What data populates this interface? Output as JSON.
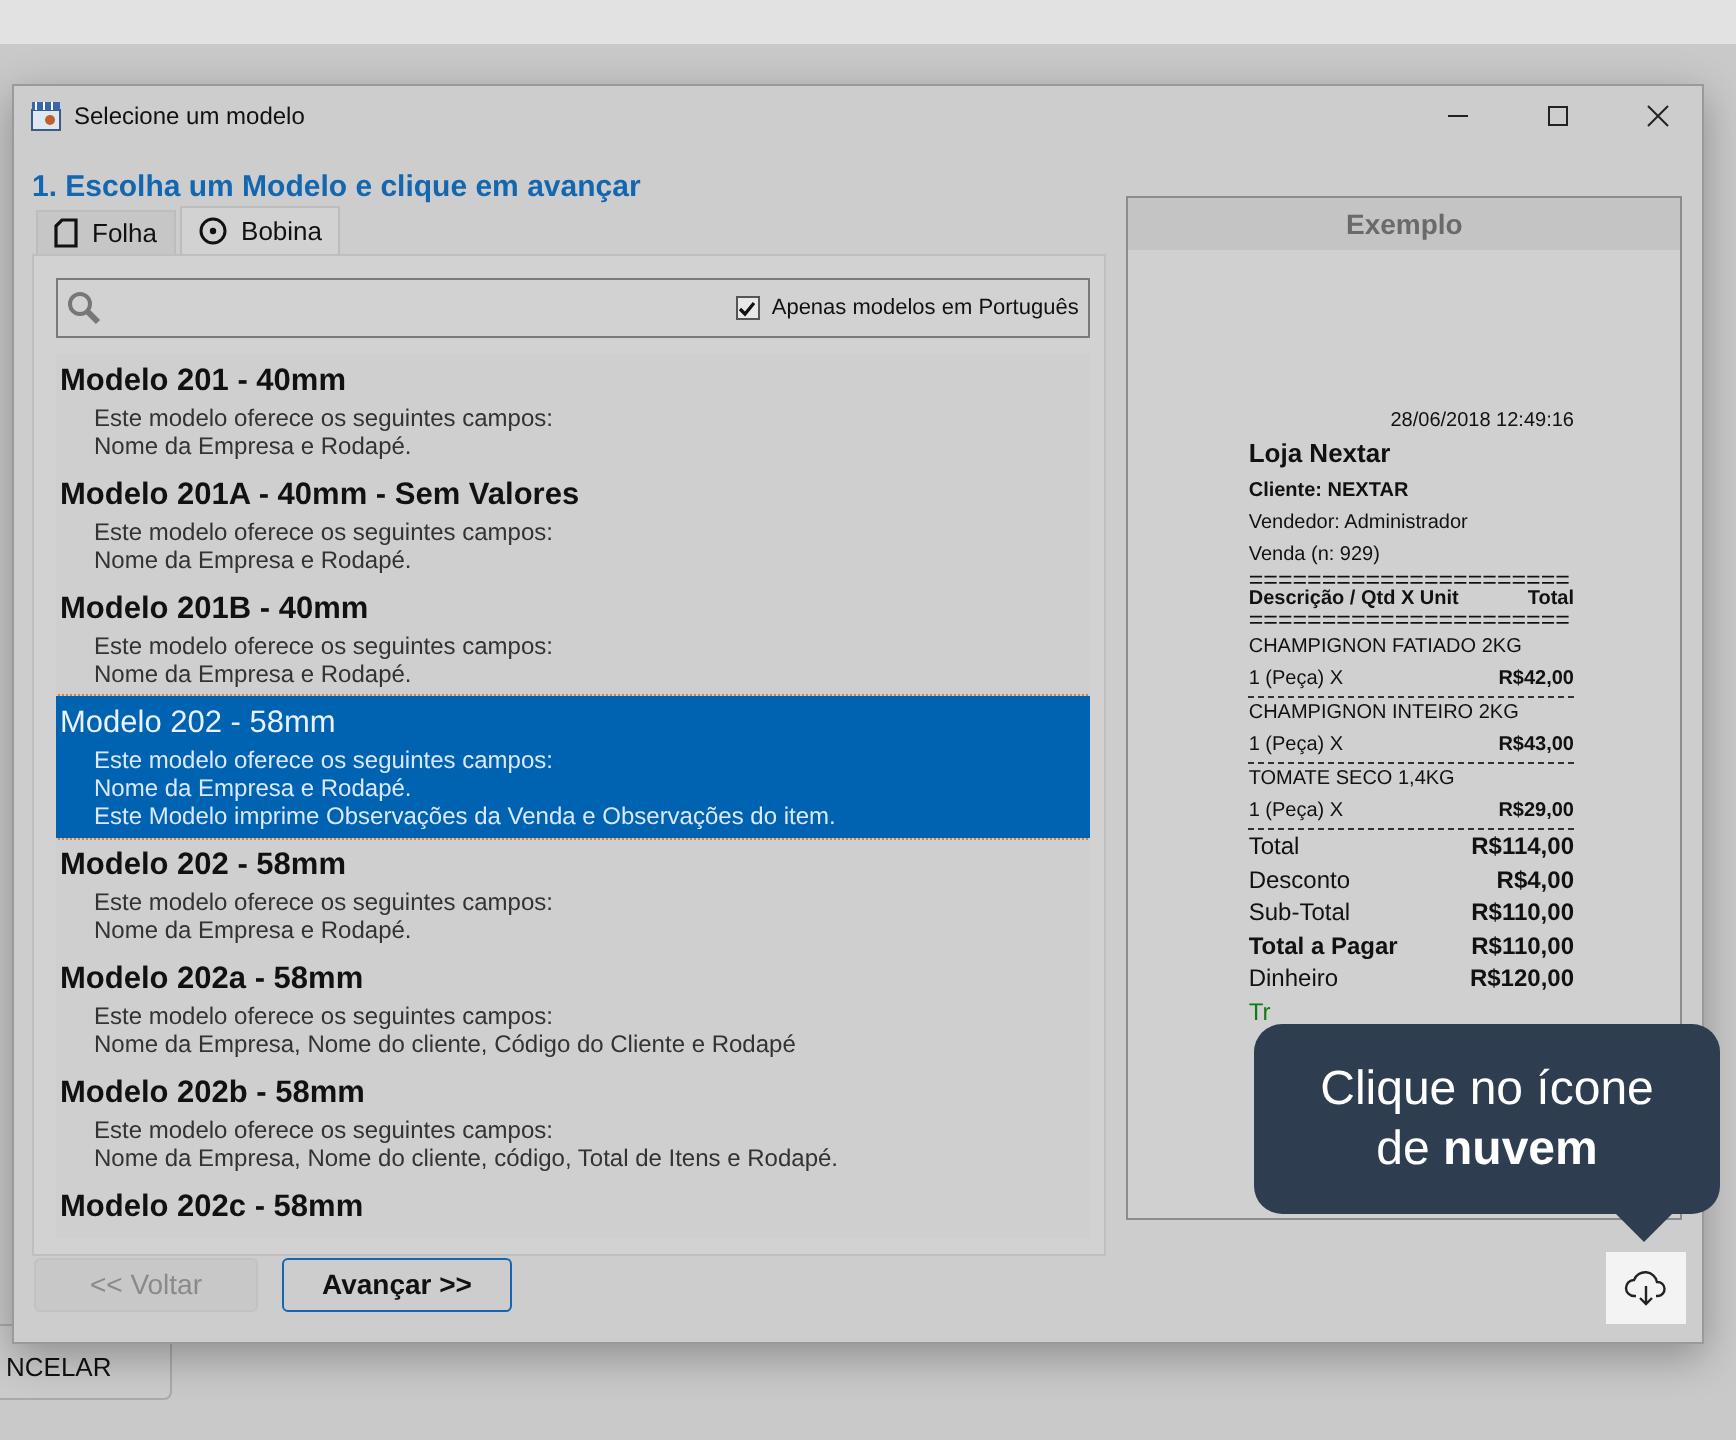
{
  "background": {
    "button": "NCELAR"
  },
  "window": {
    "title": "Selecione um modelo"
  },
  "heading": "1. Escolha um Modelo e clique em avançar",
  "tabs": [
    {
      "label": "Folha",
      "kind": "sheet",
      "selected": false
    },
    {
      "label": "Bobina",
      "kind": "roll",
      "selected": true
    }
  ],
  "filter": {
    "label": "Apenas modelos em Português",
    "checked": true
  },
  "models": [
    {
      "title": "Modelo 201 - 40mm",
      "selected": false,
      "lines": [
        "Este modelo oferece os seguintes campos:",
        "Nome da Empresa e Rodapé."
      ]
    },
    {
      "title": "Modelo 201A - 40mm - Sem Valores",
      "selected": false,
      "lines": [
        "Este modelo oferece os seguintes campos:",
        "Nome da Empresa e Rodapé."
      ]
    },
    {
      "title": "Modelo 201B - 40mm",
      "selected": false,
      "lines": [
        "Este modelo oferece os seguintes campos:",
        "Nome da Empresa e Rodapé."
      ]
    },
    {
      "title": "Modelo 202 - 58mm",
      "selected": true,
      "lines": [
        "Este modelo oferece os seguintes campos:",
        "Nome da Empresa e Rodapé.",
        "Este Modelo imprime Observações da Venda e Observações do item."
      ]
    },
    {
      "title": "Modelo 202 - 58mm",
      "selected": false,
      "lines": [
        "Este modelo oferece os seguintes campos:",
        "Nome da Empresa e Rodapé."
      ]
    },
    {
      "title": "Modelo 202a - 58mm",
      "selected": false,
      "lines": [
        "Este modelo oferece os seguintes campos:",
        "Nome da Empresa, Nome do cliente, Código do Cliente e Rodapé"
      ]
    },
    {
      "title": "Modelo 202b - 58mm",
      "selected": false,
      "lines": [
        "Este modelo oferece os seguintes campos:",
        "Nome da Empresa, Nome do cliente, código, Total de Itens e Rodapé."
      ]
    },
    {
      "title": "Modelo 202c - 58mm",
      "selected": false
    }
  ],
  "example": {
    "title": "Exemplo",
    "receipt": {
      "date": "28/06/2018 12:49:16",
      "store": "Loja Nextar",
      "client": "Cliente: NEXTAR",
      "seller": "Vendedor: Administrador",
      "sale": "Venda (n: 929)",
      "rule": "======================",
      "header": [
        "Descrição / Qtd X Unit",
        "Total"
      ],
      "items": [
        {
          "name": "CHAMPIGNON FATIADO 2KG",
          "qty": "1 (Peça) X",
          "price": "R$42,00"
        },
        {
          "name": "CHAMPIGNON INTEIRO 2KG",
          "qty": "1 (Peça) X",
          "price": "R$43,00"
        },
        {
          "name": "TOMATE SECO 1,4KG",
          "qty": "1 (Peça) X",
          "price": "R$29,00"
        }
      ],
      "totals": [
        {
          "label": "Total",
          "value": "R$114,00",
          "bold": false
        },
        {
          "label": "Desconto",
          "value": "R$4,00",
          "bold": false
        },
        {
          "label": "Sub-Total",
          "value": "R$110,00",
          "bold": false
        },
        {
          "label": "Total a Pagar",
          "value": "R$110,00",
          "bold": true
        },
        {
          "label": "Dinheiro",
          "value": "R$120,00",
          "bold": false
        },
        {
          "label": "Tr",
          "bold": false,
          "color": "#107c10"
        }
      ]
    }
  },
  "buttons": [
    {
      "label": "<< Voltar",
      "disabled": true
    },
    {
      "label": "Avançar >>",
      "disabled": false
    }
  ],
  "tooltip": "Clique no ícone de **nuvem**"
}
